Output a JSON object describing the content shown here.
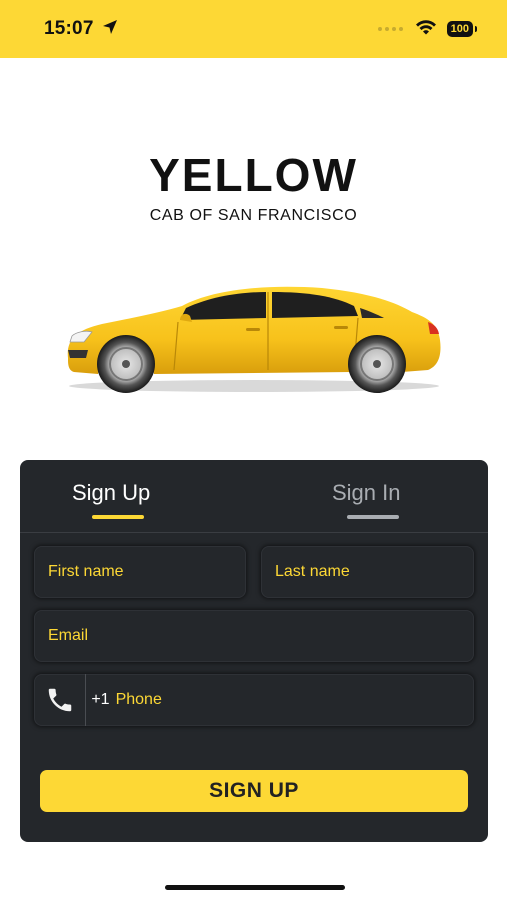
{
  "status_bar": {
    "time": "15:07",
    "battery": "100",
    "background_color": "#FDD835"
  },
  "brand": {
    "title": "YELLOW",
    "subtitle": "CAB OF SAN FRANCISCO",
    "illustration": "yellow-sedan-car"
  },
  "auth": {
    "tabs": [
      {
        "label": "Sign Up",
        "active": true
      },
      {
        "label": "Sign In",
        "active": false
      }
    ],
    "fields": {
      "first_name": {
        "placeholder": "First name",
        "value": ""
      },
      "last_name": {
        "placeholder": "Last name",
        "value": ""
      },
      "email": {
        "placeholder": "Email",
        "value": ""
      },
      "phone": {
        "icon": "phone-icon",
        "prefix": "+1",
        "placeholder": "Phone",
        "value": ""
      }
    },
    "submit_label": "SIGN UP"
  },
  "colors": {
    "accent": "#FDD835",
    "card": "#24272b",
    "inactive_tab": "#a9adb2"
  }
}
